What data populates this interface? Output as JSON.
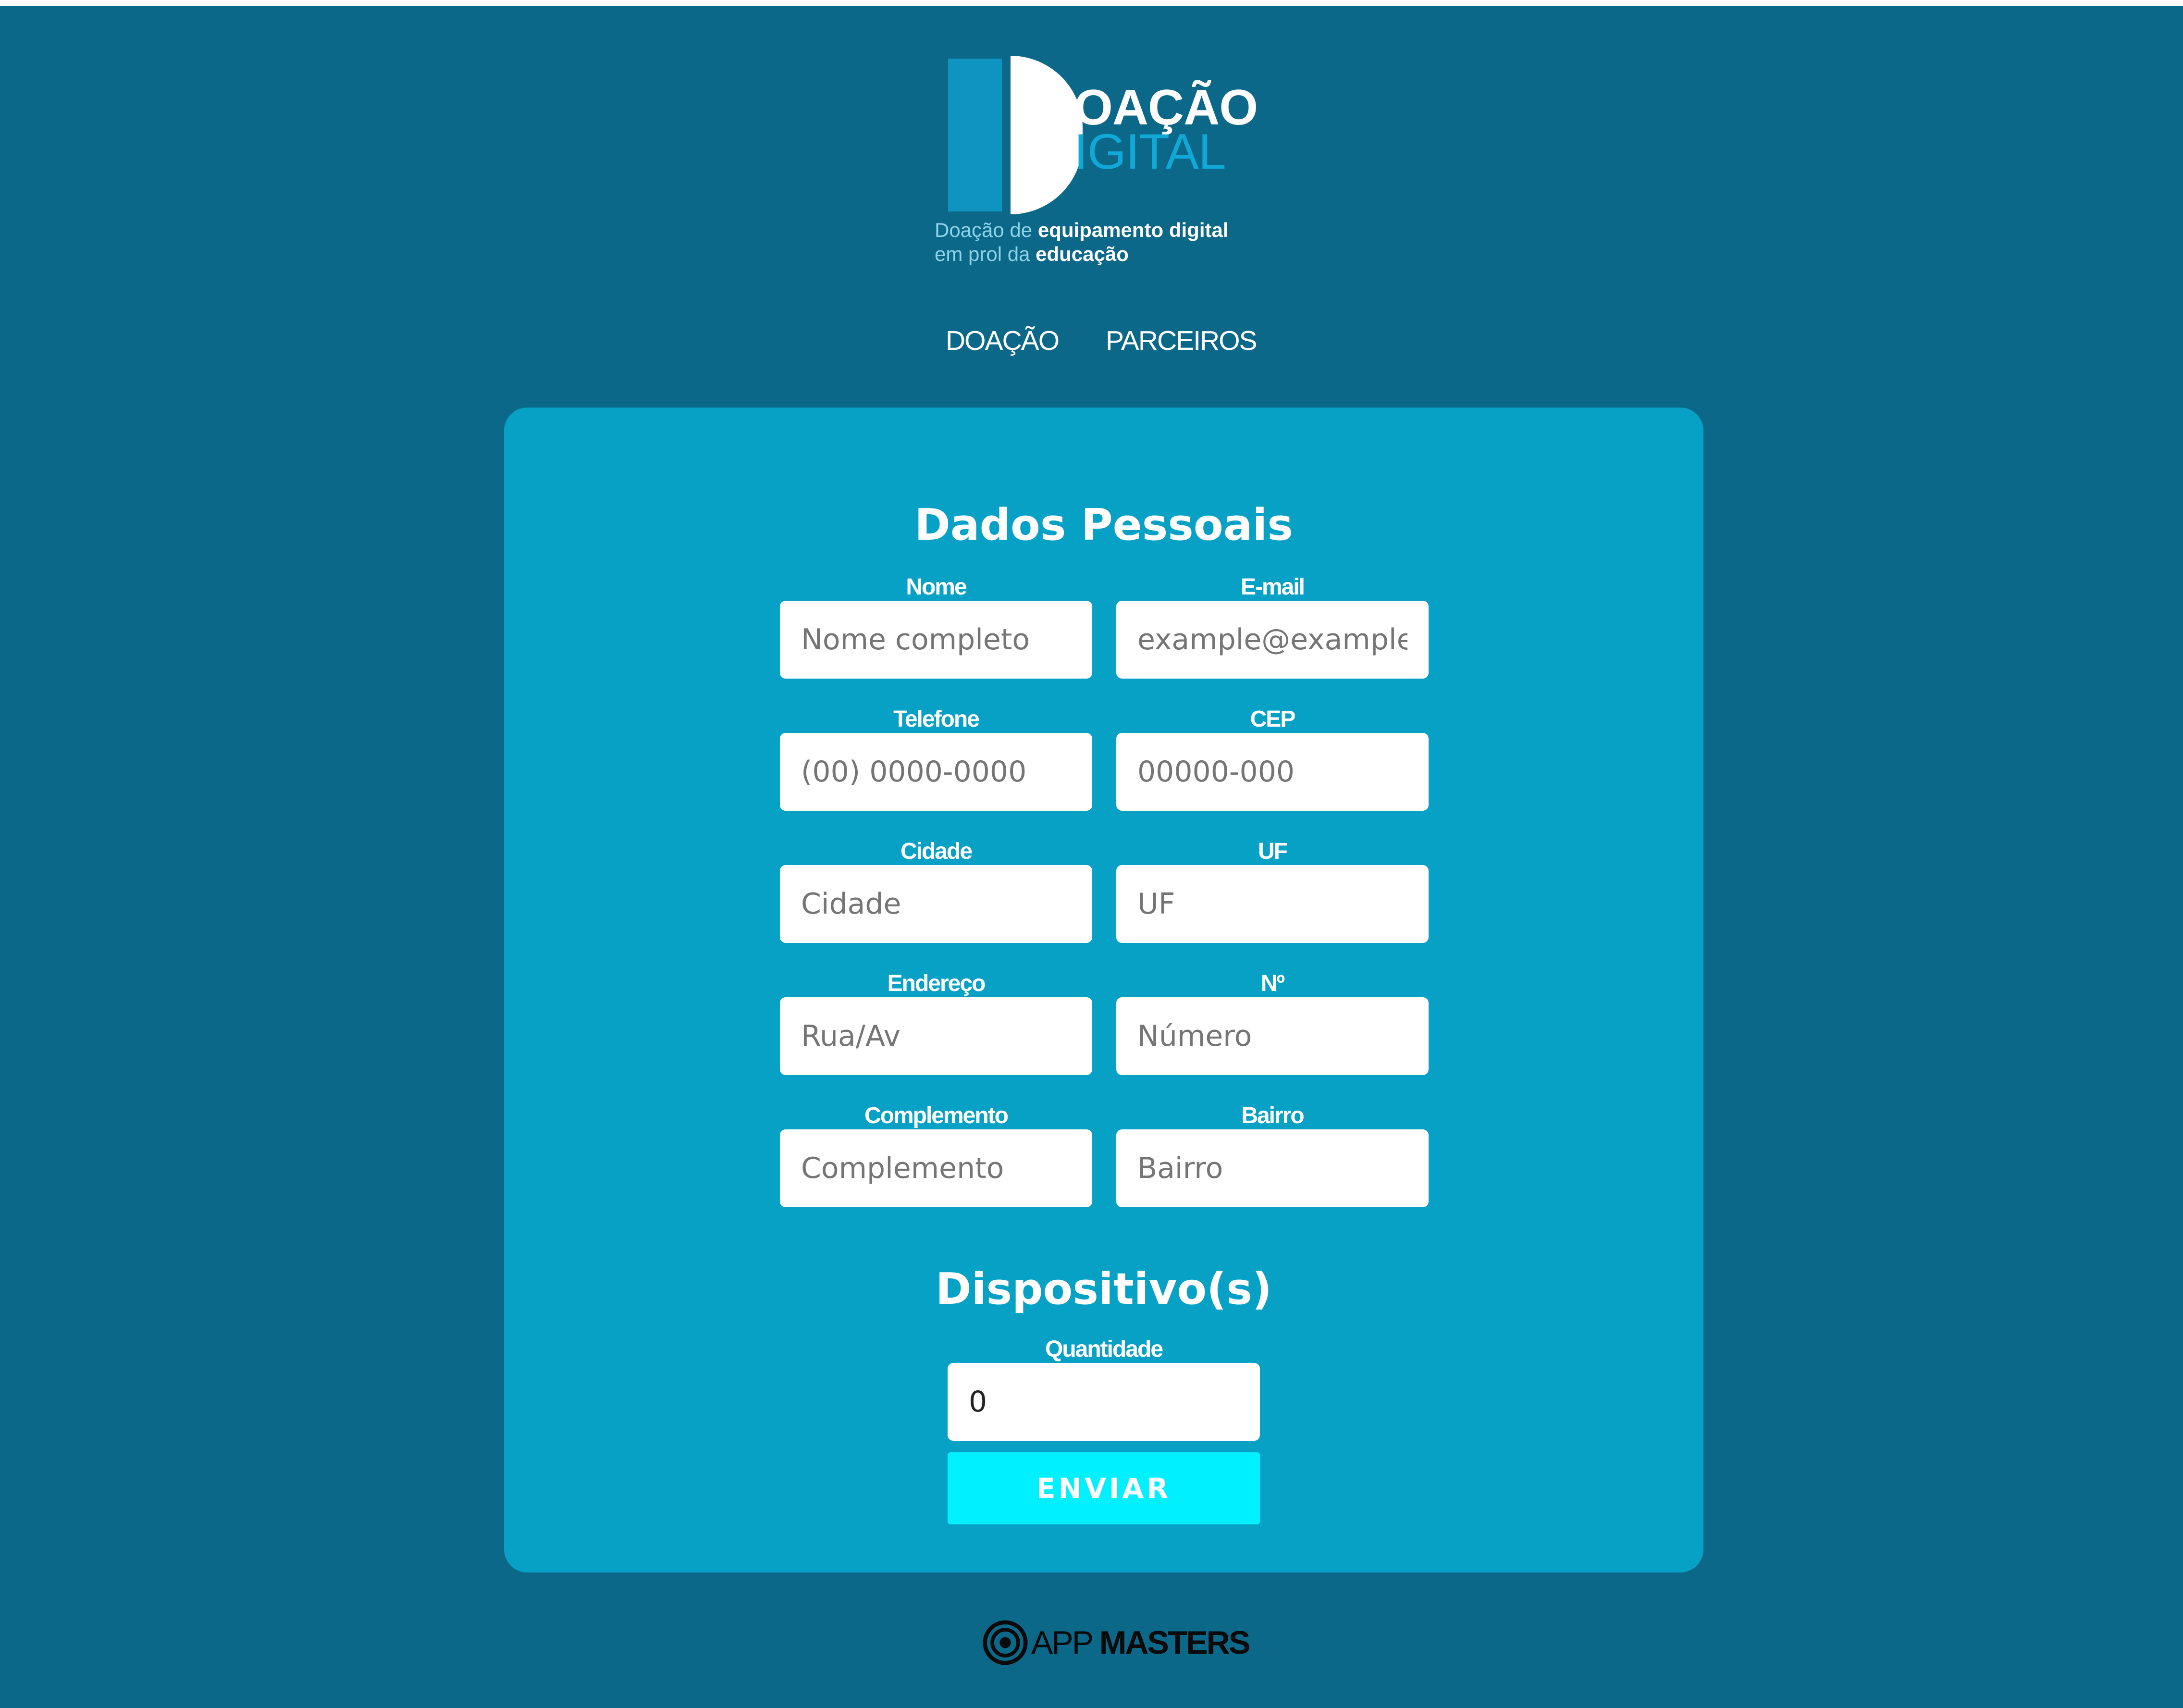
{
  "brand": {
    "logo_line1": "OAÇÃO",
    "logo_line2": "IGITAL",
    "tagline_1a": "Doação de ",
    "tagline_1b": "equipamento digital",
    "tagline_2a": "em prol da ",
    "tagline_2b": "educação"
  },
  "nav": {
    "items": [
      {
        "label": "DOAÇÃO"
      },
      {
        "label": "PARCEIROS"
      }
    ]
  },
  "form": {
    "personal_title": "Dados Pessoais",
    "fields": [
      {
        "label": "Nome",
        "placeholder": "Nome completo"
      },
      {
        "label": "E-mail",
        "placeholder": "example@example"
      },
      {
        "label": "Telefone",
        "placeholder": "(00) 0000-0000"
      },
      {
        "label": "CEP",
        "placeholder": "00000-000"
      },
      {
        "label": "Cidade",
        "placeholder": "Cidade"
      },
      {
        "label": "UF",
        "placeholder": "UF"
      },
      {
        "label": "Endereço",
        "placeholder": "Rua/Av"
      },
      {
        "label": "Nº",
        "placeholder": "Número"
      },
      {
        "label": "Complemento",
        "placeholder": "Complemento"
      },
      {
        "label": "Bairro",
        "placeholder": "Bairro"
      }
    ],
    "device_title": "Dispositivo(s)",
    "quantity": {
      "label": "Quantidade",
      "value": "0"
    },
    "submit_label": "ENVIAR"
  },
  "footer": {
    "brand_light": "APP ",
    "brand_bold": "MASTERS"
  },
  "colors": {
    "page_background": "#0b6889",
    "card_background": "#07a1c6",
    "button": "#00f0ff",
    "logo_accent": "#0f94c2"
  }
}
